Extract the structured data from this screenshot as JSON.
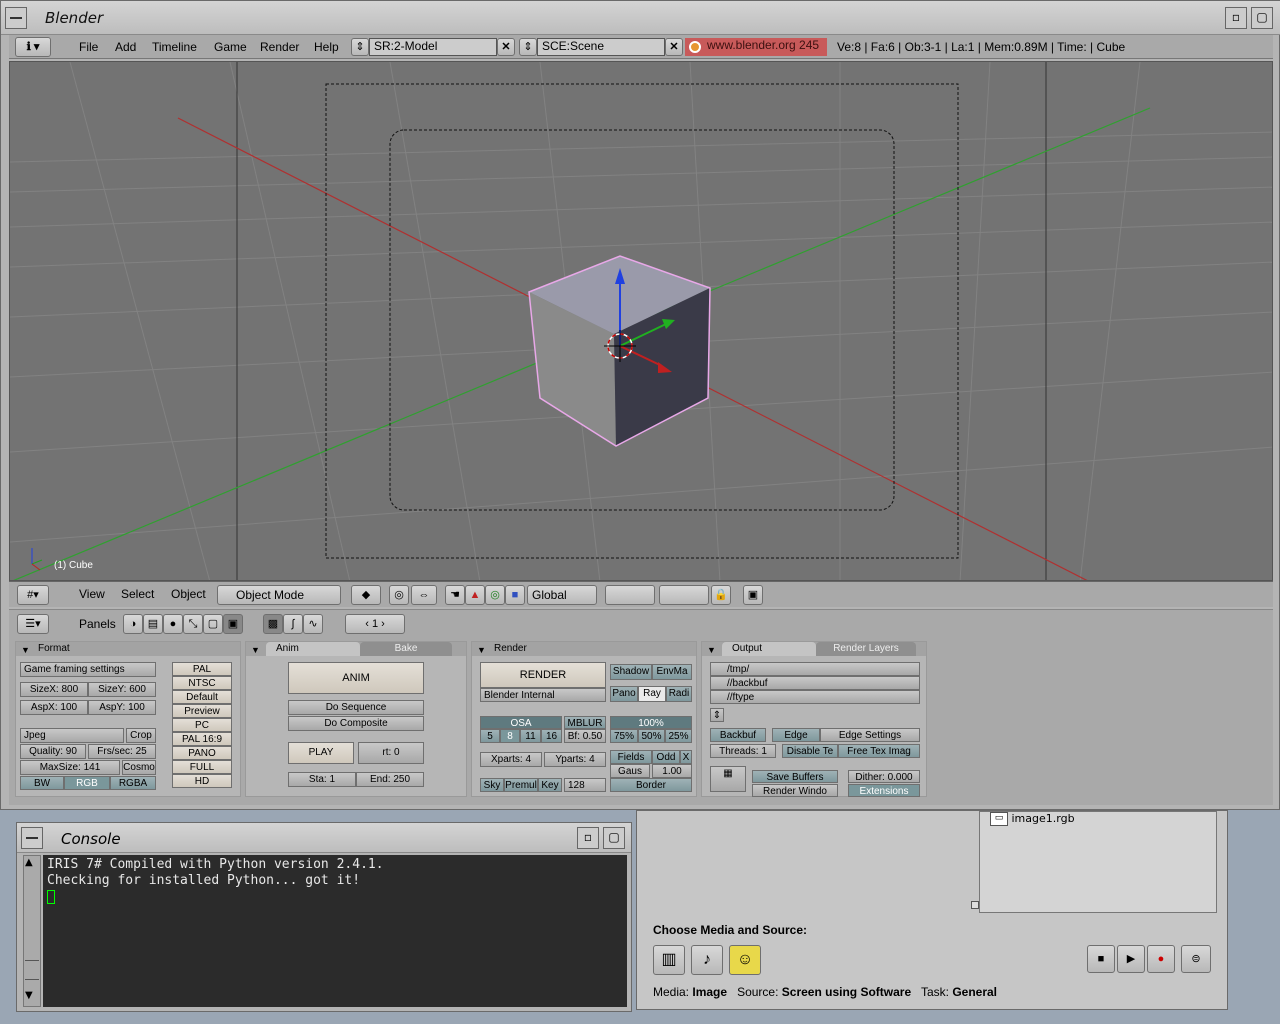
{
  "blender": {
    "title": "Blender",
    "menus": [
      "File",
      "Add",
      "Timeline",
      "Game",
      "Render",
      "Help"
    ],
    "screen": "SR:2-Model",
    "scene": "SCE:Scene",
    "url": "www.blender.org 245",
    "stats": "Ve:8 | Fa:6 | Ob:3-1 | La:1  | Mem:0.89M  | Time: | Cube",
    "viewport_label": "(1) Cube",
    "view_menus": [
      "View",
      "Select",
      "Object"
    ],
    "mode": "Object Mode",
    "orientation": "Global",
    "panels_label": "Panels",
    "frame": "1"
  },
  "format_panel": {
    "title": "Format",
    "preset": "Game framing settings",
    "sizex": "SizeX: 800",
    "sizey": "SizeY: 600",
    "aspx": "AspX: 100",
    "aspy": "AspY: 100",
    "filetype": "Jpeg",
    "crop": "Crop",
    "quality": "Quality: 90",
    "fps": "Frs/sec: 25",
    "maxsize": "MaxSize: 141",
    "cosmo": "Cosmo",
    "bw": "BW",
    "rgb": "RGB",
    "rgba": "RGBA",
    "presets": [
      "PAL",
      "NTSC",
      "Default",
      "Preview",
      "PC",
      "PAL 16:9",
      "PANO",
      "FULL",
      "HD"
    ]
  },
  "anim_panel": {
    "tab": "Anim",
    "tab2": "Bake",
    "anim": "ANIM",
    "do_sequence": "Do Sequence",
    "do_composite": "Do Composite",
    "play": "PLAY",
    "rt": "rt: 0",
    "sta": "Sta: 1",
    "end": "End: 250"
  },
  "render_panel": {
    "title": "Render",
    "render": "RENDER",
    "engine": "Blender Internal",
    "shadow": "Shadow",
    "envmap": "EnvMa",
    "pano": "Pano",
    "ray": "Ray",
    "radio": "Radi",
    "osa": "OSA",
    "osa_values": [
      "5",
      "8",
      "11",
      "16"
    ],
    "mblur": "MBLUR",
    "bf": "Bf: 0.50",
    "percent": "100%",
    "percents": [
      "75%",
      "50%",
      "25%"
    ],
    "xparts": "Xparts: 4",
    "yparts": "Yparts: 4",
    "fields": "Fields",
    "odd": "Odd",
    "x": "X",
    "gauss": "Gaus",
    "gauss_val": "1.00",
    "sky": "Sky",
    "premul": "Premul",
    "key": "Key",
    "depth": "128",
    "border": "Border"
  },
  "output_panel": {
    "tab": "Output",
    "tab2": "Render Layers",
    "paths": [
      "/tmp/",
      "//backbuf",
      "//ftype"
    ],
    "backbuf": "Backbuf",
    "edge": "Edge",
    "edge_settings": "Edge Settings",
    "threads": "Threads: 1",
    "disable_tex": "Disable Te",
    "free_tex": "Free Tex Imag",
    "save_buffers": "Save Buffers",
    "dither": "Dither: 0.000",
    "render_window": "Render Windo",
    "extensions": "Extensions"
  },
  "console": {
    "title": "Console",
    "lines": [
      "IRIS 7# Compiled with Python version 2.4.1.",
      "Checking for installed Python... got it!"
    ]
  },
  "media": {
    "list_item": "image1.rgb",
    "choose": "Choose Media and Source:",
    "media_label": "Media:",
    "media_value": "Image",
    "source_label": "Source:",
    "source_value": "Screen using Software",
    "task_label": "Task:",
    "task_value": "General"
  },
  "colors": {
    "viewport_bg": "#737373",
    "url_badge": "#c85a5a",
    "axis_x": "#c02020",
    "axis_y": "#20a020",
    "axis_z": "#2040e0",
    "selection": "#e8a8e8"
  }
}
